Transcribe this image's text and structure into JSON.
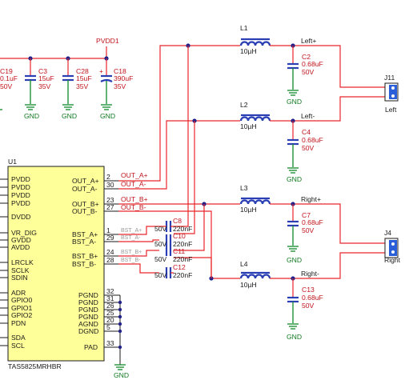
{
  "power": {
    "label": "PVDD1"
  },
  "ground": {
    "label": "GND"
  },
  "ic": {
    "ref": "U1",
    "part": "TAS5825MRHBR",
    "left_pins": [
      "PVDD",
      "PVDD",
      "PVDD",
      "PVDD",
      "DVDD",
      "VR_DIG",
      "GVDD",
      "AVDD",
      "LRCLK",
      "SCLK",
      "SDIN",
      "ADR",
      "GPIO0",
      "GPIO1",
      "GPIO2",
      "PDN",
      "SDA",
      "SCL"
    ],
    "right_pins": [
      {
        "name": "OUT_A+",
        "num": "2"
      },
      {
        "name": "OUT_A-",
        "num": "30"
      },
      {
        "name": "OUT_B+",
        "num": "23"
      },
      {
        "name": "OUT_B-",
        "num": "27"
      },
      {
        "name": "BST_A+",
        "num": "1"
      },
      {
        "name": "BST_A-",
        "num": "29"
      },
      {
        "name": "BST_B+",
        "num": "24"
      },
      {
        "name": "BST_B-",
        "num": "28"
      },
      {
        "name": "PGND",
        "num": "32"
      },
      {
        "name": "PGND",
        "num": "31"
      },
      {
        "name": "PGND",
        "num": "26"
      },
      {
        "name": "PGND",
        "num": "25"
      },
      {
        "name": "AGND",
        "num": "20"
      },
      {
        "name": "DGND",
        "num": "5"
      },
      {
        "name": "PAD",
        "num": "33"
      }
    ]
  },
  "nets": {
    "out_a_p": "OUT_A+",
    "out_a_n": "OUT_A-",
    "out_b_p": "OUT_B+",
    "out_b_n": "OUT_B-",
    "bst_a_p": "BST_A+",
    "bst_a_n": "BST_A-",
    "bst_b_p": "BST_B+",
    "bst_b_n": "BST_B-"
  },
  "supply_caps": [
    {
      "ref": "C19",
      "value": "0.1uF",
      "voltage": "50V"
    },
    {
      "ref": "C3",
      "value": "15uF",
      "voltage": "35V"
    },
    {
      "ref": "C28",
      "value": "15uF",
      "voltage": "35V"
    },
    {
      "ref": "C18",
      "value": "390uF",
      "voltage": "35V",
      "polarity": "+"
    }
  ],
  "bootstrap_caps": [
    {
      "ref": "C8",
      "value": "220nF",
      "voltage": "50V"
    },
    {
      "ref": "C10",
      "value": "220nF",
      "voltage": "50V"
    },
    {
      "ref": "C11",
      "value": "220nF",
      "voltage": "50V"
    },
    {
      "ref": "C12",
      "value": "220nF",
      "voltage": "50V"
    }
  ],
  "inductors": [
    {
      "ref": "L1",
      "value": "10µH"
    },
    {
      "ref": "L2",
      "value": "10µH"
    },
    {
      "ref": "L3",
      "value": "10µH"
    },
    {
      "ref": "L4",
      "value": "10µH"
    }
  ],
  "filter_caps": [
    {
      "ref": "C2",
      "value": "0.68uF",
      "voltage": "50V"
    },
    {
      "ref": "C4",
      "value": "0.68uF",
      "voltage": "50V"
    },
    {
      "ref": "C7",
      "value": "0.68uF",
      "voltage": "50V"
    },
    {
      "ref": "C13",
      "value": "0.68uF",
      "voltage": "50V"
    }
  ],
  "out_labels": {
    "left_p": "Left+",
    "left_n": "Left-",
    "right_p": "Right+",
    "right_n": "Right-"
  },
  "connectors": [
    {
      "ref": "J11",
      "name": "Left"
    },
    {
      "ref": "J4",
      "name": "Right"
    }
  ]
}
